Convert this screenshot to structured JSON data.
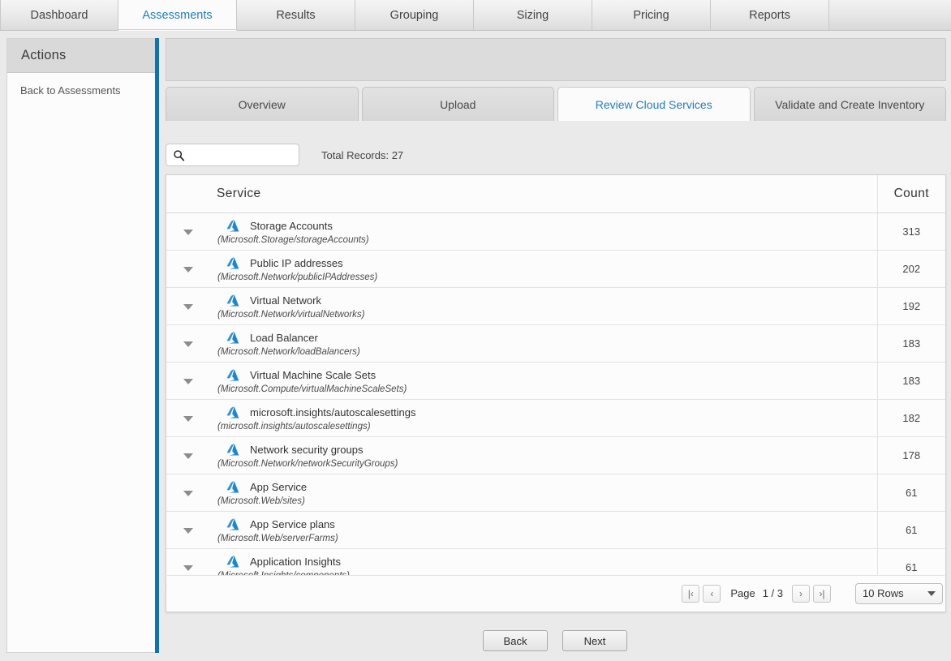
{
  "topnav": {
    "tabs": [
      {
        "label": "Dashboard",
        "active": false
      },
      {
        "label": "Assessments",
        "active": true
      },
      {
        "label": "Results",
        "active": false
      },
      {
        "label": "Grouping",
        "active": false
      },
      {
        "label": "Sizing",
        "active": false
      },
      {
        "label": "Pricing",
        "active": false
      },
      {
        "label": "Reports",
        "active": false
      }
    ]
  },
  "sidebar": {
    "title": "Actions",
    "accent_color": "#0b73ba",
    "items": [
      {
        "label": "Back to Assessments"
      }
    ]
  },
  "subtabs": [
    {
      "label": "Overview",
      "active": false
    },
    {
      "label": "Upload",
      "active": false
    },
    {
      "label": "Review Cloud Services",
      "active": true
    },
    {
      "label": "Validate and Create Inventory",
      "active": false
    }
  ],
  "search": {
    "value": "",
    "placeholder": "",
    "icon": "search-icon"
  },
  "total_records_label": "Total Records: 27",
  "table": {
    "columns": [
      "Service",
      "Count"
    ],
    "row_icon": "azure-icon",
    "expand_icon": "chevron-down-icon",
    "rows": [
      {
        "service": "Storage Accounts",
        "resource_type": "(Microsoft.Storage/storageAccounts)",
        "count": "313"
      },
      {
        "service": "Public IP addresses",
        "resource_type": "(Microsoft.Network/publicIPAddresses)",
        "count": "202"
      },
      {
        "service": "Virtual Network",
        "resource_type": "(Microsoft.Network/virtualNetworks)",
        "count": "192"
      },
      {
        "service": "Load Balancer",
        "resource_type": "(Microsoft.Network/loadBalancers)",
        "count": "183"
      },
      {
        "service": "Virtual Machine Scale Sets",
        "resource_type": "(Microsoft.Compute/virtualMachineScaleSets)",
        "count": "183"
      },
      {
        "service": "microsoft.insights/autoscalesettings",
        "resource_type": "(microsoft.insights/autoscalesettings)",
        "count": "182"
      },
      {
        "service": "Network security groups",
        "resource_type": "(Microsoft.Network/networkSecurityGroups)",
        "count": "178"
      },
      {
        "service": "App Service",
        "resource_type": "(Microsoft.Web/sites)",
        "count": "61"
      },
      {
        "service": "App Service plans",
        "resource_type": "(Microsoft.Web/serverFarms)",
        "count": "61"
      },
      {
        "service": "Application Insights",
        "resource_type": "(Microsoft.Insights/components)",
        "count": "61"
      }
    ]
  },
  "pagination": {
    "first_label": "|‹",
    "prev_label": "‹",
    "page_label": "Page",
    "page_value": "1 / 3",
    "next_label": "›",
    "last_label": "›|",
    "rows_per_page": "10 Rows"
  },
  "footer": {
    "back_label": "Back",
    "next_label": "Next"
  }
}
